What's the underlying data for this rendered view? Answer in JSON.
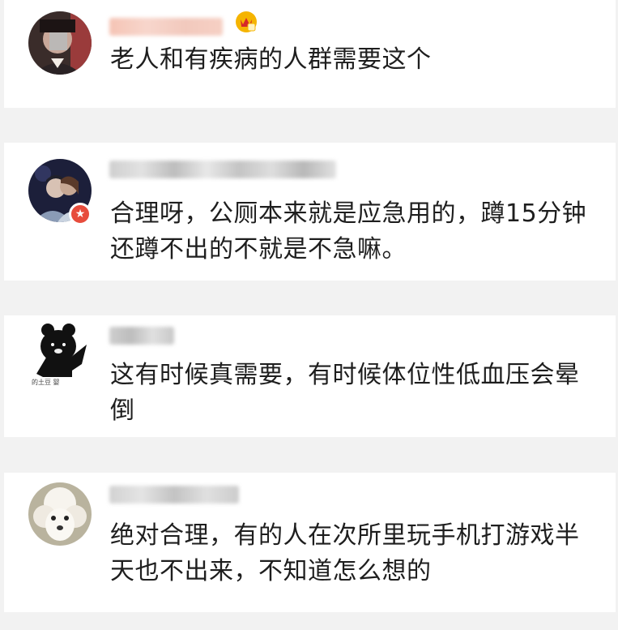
{
  "comments": [
    {
      "name_hidden": true,
      "has_vip_badge": true,
      "avatar": "blurred-face-photo",
      "text": "老人和有疾病的人群需要这个"
    },
    {
      "name_hidden": true,
      "has_verified_badge": true,
      "avatar": "couple-night-photo",
      "text": "合理呀，公厕本来就是应急用的，蹲15分钟还蹲不出的不就是不急嘛。"
    },
    {
      "name_hidden": true,
      "avatar": "black-bear-cartoon",
      "avatar_caption": "的土豆 婴",
      "text": "这有时候真需要，有时候体位性低血压会晕倒"
    },
    {
      "name_hidden": true,
      "avatar": "white-poodle-photo",
      "text": "绝对合理，有的人在次所里玩手机打游戏半天也不出来，不知道怎么想的"
    }
  ],
  "colors": {
    "background": "#f2f2f2",
    "card": "#ffffff",
    "text": "#1e1e1e",
    "badge_red": "#e74c3c",
    "vip_gold": "#f5b400"
  }
}
